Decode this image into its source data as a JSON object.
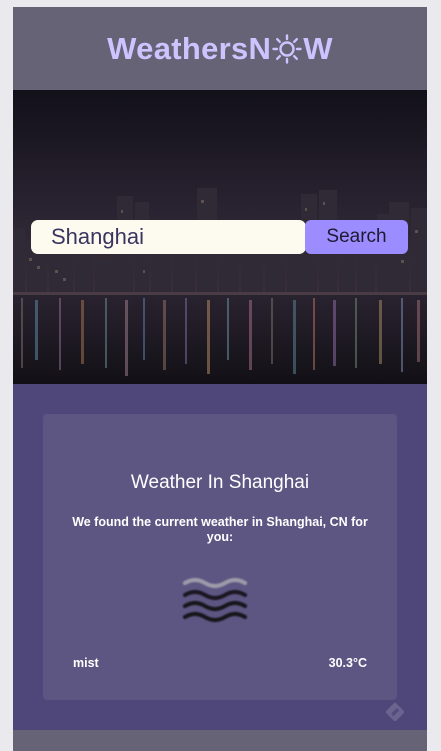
{
  "header": {
    "logo_prefix": "WeathersN",
    "logo_suffix": "W",
    "logo_color": "#cdc4ff",
    "logo_icon": "sun-icon"
  },
  "search": {
    "value": "Shanghai",
    "button_label": "Search"
  },
  "weather": {
    "title": "Weather In Shanghai",
    "description": "We found the current weather in Shanghai, CN for you:",
    "icon": "mist-icon",
    "condition": "mist",
    "temperature": "30.3°C"
  },
  "colors": {
    "header_bg": "#676376",
    "page_bg": "#4f477a",
    "card_bg": "#5d5683",
    "button_bg": "#9b8cff",
    "input_bg": "#fdfbef"
  }
}
